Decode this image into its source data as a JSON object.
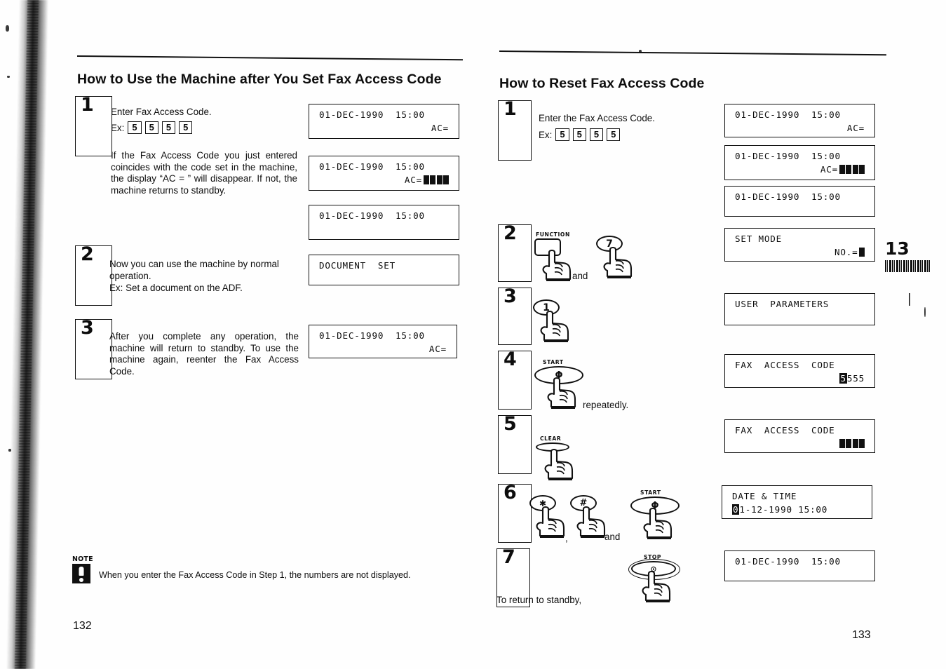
{
  "document": {
    "type": "fax-machine-user-manual-spread",
    "chapter_tab": {
      "number": "13"
    }
  },
  "left_page": {
    "folio": "132",
    "title": "How to Use the Machine after You Set Fax Access Code",
    "steps": [
      {
        "number": "1",
        "paragraphs": [
          "Enter Fax Access Code.",
          "If the Fax Access Code you just entered coincides with the code set in the machine, the display “AC = ” will disappear. If not, the machine returns to standby."
        ],
        "example_label": "Ex:",
        "example_keys": [
          "5",
          "5",
          "5",
          "5"
        ]
      },
      {
        "number": "2",
        "paragraphs": [
          "Now you can use the machine by normal operation.",
          "Ex: Set a document on the ADF."
        ]
      },
      {
        "number": "3",
        "paragraphs": [
          "After you complete any operation, the machine will return to standby. To use the machine again, reenter the Fax Access Code."
        ]
      }
    ],
    "displays": [
      {
        "line1": "01-DEC-1990  15:00",
        "line2": "AC=",
        "line2_align": "right",
        "blocks": 0
      },
      {
        "line1": "01-DEC-1990  15:00",
        "line2": "AC=",
        "line2_align": "right",
        "blocks": 4
      },
      {
        "line1": "01-DEC-1990  15:00",
        "line2": "",
        "line2_align": "right",
        "blocks": 0
      },
      {
        "line1": "DOCUMENT  SET",
        "line2": "",
        "line2_align": "left",
        "blocks": 0
      },
      {
        "line1": "01-DEC-1990  15:00",
        "line2": "AC=",
        "line2_align": "right",
        "blocks": 0
      }
    ],
    "note": {
      "tag": "NOTE",
      "icon": "exclamation-icon",
      "text": "When you enter the Fax Access Code in Step 1, the numbers are not displayed."
    }
  },
  "right_page": {
    "folio": "133",
    "title": "How to Reset Fax Access Code",
    "steps": [
      {
        "number": "1",
        "paragraphs": [
          "Enter the Fax Access Code."
        ],
        "example_label": "Ex:",
        "example_keys": [
          "5",
          "5",
          "5",
          "5"
        ]
      },
      {
        "number": "2",
        "keys": [
          "FUNCTION",
          "7"
        ],
        "connector": "and"
      },
      {
        "number": "3",
        "keys": [
          "1"
        ]
      },
      {
        "number": "4",
        "keys": [
          "START"
        ],
        "trailing_text": "repeatedly."
      },
      {
        "number": "5",
        "keys": [
          "CLEAR"
        ]
      },
      {
        "number": "6",
        "keys": [
          "✱",
          "#",
          "START"
        ],
        "connector": "and",
        "separator": ","
      },
      {
        "number": "7",
        "keys": [
          "STOP"
        ],
        "leading_text": "To return to standby,"
      }
    ],
    "key_labels": {
      "function": "FUNCTION",
      "start": "START",
      "clear": "CLEAR",
      "stop": "STOP",
      "seven": "7",
      "one": "1",
      "asterisk": "✱",
      "hash": "#",
      "start_glyph": "Φ",
      "stop_glyph": "⊙"
    },
    "displays": [
      {
        "line1": "01-DEC-1990  15:00",
        "line2": "AC=",
        "line2_align": "right",
        "blocks": 0
      },
      {
        "line1": "01-DEC-1990  15:00",
        "line2": "AC=",
        "line2_align": "right",
        "blocks": 4
      },
      {
        "line1": "01-DEC-1990  15:00",
        "line2": "",
        "line2_align": "left",
        "blocks": 0
      },
      {
        "line1": "SET MODE",
        "line2": "NO.=",
        "line2_align": "right",
        "blocks": 1
      },
      {
        "line1": "USER  PARAMETERS",
        "line2": "",
        "line2_align": "left",
        "blocks": 0
      },
      {
        "line1": "FAX  ACCESS  CODE",
        "line2_inverted": "5",
        "line2_rest": "555",
        "line2_align": "right"
      },
      {
        "line1": "FAX  ACCESS  CODE",
        "line2": "",
        "line2_align": "right",
        "blocks": 4
      },
      {
        "line1": "DATE & TIME",
        "line2_inverted": "0",
        "line2_rest": "1-12-1990 15:00",
        "line2_align": "left"
      },
      {
        "line1": "01-DEC-1990  15:00",
        "line2": "",
        "line2_align": "left",
        "blocks": 0
      }
    ],
    "text_fragments": {
      "repeatedly": "repeatedly.",
      "and": "and",
      "comma": ",",
      "return_to_standby": "To return to standby,"
    }
  },
  "colors": {
    "ink": "#0d0d0d",
    "paper": "#fefefe",
    "lcd_block": "#111111"
  }
}
